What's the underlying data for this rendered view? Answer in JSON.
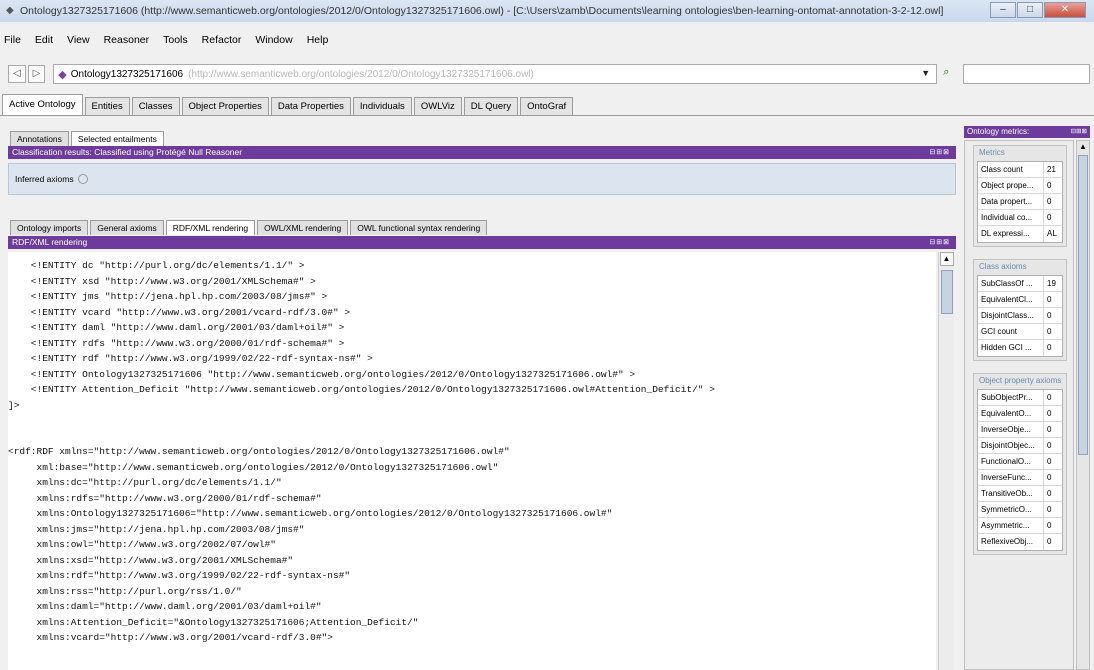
{
  "window": {
    "title": "Ontology1327325171606 (http://www.semanticweb.org/ontologies/2012/0/Ontology1327325171606.owl) - [C:\\Users\\zamb\\Documents\\learning ontologies\\ben-learning-ontomat-annotation-3-2-12.owl]",
    "icon": "protege-app-icon",
    "minimize": "–",
    "maximize": "□",
    "close": "✕"
  },
  "menu": [
    "File",
    "Edit",
    "View",
    "Reasoner",
    "Tools",
    "Refactor",
    "Window",
    "Help"
  ],
  "toolbar": {
    "back": "◁",
    "forward": "▷",
    "ontology_name": "Ontology1327325171606",
    "ontology_iri": "(http://www.semanticweb.org/ontologies/2012/0/Ontology1327325171606.owl)",
    "dropdown": "▼",
    "search_glyph": "⌕",
    "search_placeholder": ""
  },
  "main_tabs": [
    "Active Ontology",
    "Entities",
    "Classes",
    "Object Properties",
    "Data Properties",
    "Individuals",
    "OWLViz",
    "DL Query",
    "OntoGraf"
  ],
  "annotations_tabs": [
    "Annotations",
    "Selected entailments"
  ],
  "classification": {
    "header": "Classification results: Classified using Protégé Null Reasoner",
    "header_buttons": "⊟⊞⊠",
    "inferred_label": "Inferred axioms"
  },
  "rendering_tabs": [
    "Ontology imports",
    "General axioms",
    "RDF/XML rendering",
    "OWL/XML rendering",
    "OWL functional syntax rendering"
  ],
  "rdf_view": {
    "header": "RDF/XML rendering",
    "header_buttons": "⊟⊞⊠",
    "lines": [
      "    <!ENTITY dc \"http://purl.org/dc/elements/1.1/\" >",
      "    <!ENTITY xsd \"http://www.w3.org/2001/XMLSchema#\" >",
      "    <!ENTITY jms \"http://jena.hpl.hp.com/2003/08/jms#\" >",
      "    <!ENTITY vcard \"http://www.w3.org/2001/vcard-rdf/3.0#\" >",
      "    <!ENTITY daml \"http://www.daml.org/2001/03/daml+oil#\" >",
      "    <!ENTITY rdfs \"http://www.w3.org/2000/01/rdf-schema#\" >",
      "    <!ENTITY rdf \"http://www.w3.org/1999/02/22-rdf-syntax-ns#\" >",
      "    <!ENTITY Ontology1327325171606 \"http://www.semanticweb.org/ontologies/2012/0/Ontology1327325171606.owl#\" >",
      "    <!ENTITY Attention_Deficit \"http://www.semanticweb.org/ontologies/2012/0/Ontology1327325171606.owl#Attention_Deficit/\" >",
      "]>",
      "",
      "",
      "<rdf:RDF xmlns=\"http://www.semanticweb.org/ontologies/2012/0/Ontology1327325171606.owl#\"",
      "     xml:base=\"http://www.semanticweb.org/ontologies/2012/0/Ontology1327325171606.owl\"",
      "     xmlns:dc=\"http://purl.org/dc/elements/1.1/\"",
      "     xmlns:rdfs=\"http://www.w3.org/2000/01/rdf-schema#\"",
      "     xmlns:Ontology1327325171606=\"http://www.semanticweb.org/ontologies/2012/0/Ontology1327325171606.owl#\"",
      "     xmlns:jms=\"http://jena.hpl.hp.com/2003/08/jms#\"",
      "     xmlns:owl=\"http://www.w3.org/2002/07/owl#\"",
      "     xmlns:xsd=\"http://www.w3.org/2001/XMLSchema#\"",
      "     xmlns:rdf=\"http://www.w3.org/1999/02/22-rdf-syntax-ns#\"",
      "     xmlns:rss=\"http://purl.org/rss/1.0/\"",
      "     xmlns:daml=\"http://www.daml.org/2001/03/daml+oil#\"",
      "     xmlns:Attention_Deficit=\"&Ontology1327325171606;Attention_Deficit/\"",
      "     xmlns:vcard=\"http://www.w3.org/2001/vcard-rdf/3.0#\">"
    ]
  },
  "scroll": {
    "up": "▲",
    "down": "▼"
  },
  "metrics": {
    "header": "Ontology metrics:",
    "header_buttons": "⊟⊞⊠",
    "groups": [
      {
        "title": "Metrics",
        "rows": [
          {
            "k": "Class count",
            "v": "21"
          },
          {
            "k": "Object prope...",
            "v": "0"
          },
          {
            "k": "Data propert...",
            "v": "0"
          },
          {
            "k": "Individual co...",
            "v": "0"
          },
          {
            "k": "DL expressi...",
            "v": "AL"
          }
        ]
      },
      {
        "title": "Class axioms",
        "rows": [
          {
            "k": "SubClassOf ...",
            "v": "19"
          },
          {
            "k": "EquivalentCl...",
            "v": "0"
          },
          {
            "k": "DisjointClass...",
            "v": "0"
          },
          {
            "k": "GCI count",
            "v": "0"
          },
          {
            "k": "Hidden GCI ...",
            "v": "0"
          }
        ]
      },
      {
        "title": "Object property axioms",
        "rows": [
          {
            "k": "SubObjectPr...",
            "v": "0"
          },
          {
            "k": "EquivalentO...",
            "v": "0"
          },
          {
            "k": "InverseObje...",
            "v": "0"
          },
          {
            "k": "DisjointObjec...",
            "v": "0"
          },
          {
            "k": "FunctionalO...",
            "v": "0"
          },
          {
            "k": "InverseFunc...",
            "v": "0"
          },
          {
            "k": "TransitiveOb...",
            "v": "0"
          },
          {
            "k": "SymmetricO...",
            "v": "0"
          },
          {
            "k": "Asymmetric...",
            "v": "0"
          },
          {
            "k": "ReflexiveObj...",
            "v": "0"
          }
        ]
      }
    ]
  }
}
